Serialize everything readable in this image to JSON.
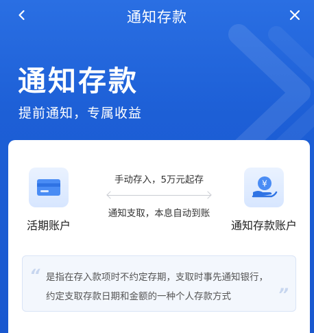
{
  "nav": {
    "title": "通知存款",
    "back_icon": "chevron-left-icon",
    "close_icon": "close-icon"
  },
  "hero": {
    "title": "通知存款",
    "subtitle": "提前通知，专属收益"
  },
  "card": {
    "left_account": {
      "label": "活期账户",
      "icon": "bank-card-icon"
    },
    "right_account": {
      "label": "通知存款账户",
      "icon": "hand-coin-icon",
      "currency_symbol": "¥"
    },
    "flow": {
      "top_text": "手动存入，5万元起存",
      "bottom_text": "通知支取，本息自动到账"
    },
    "note": {
      "text": "是指在存入款项时不约定存期，支取时事先通知银行，约定支取存款日期和金额的一种个人存款方式"
    }
  },
  "colors": {
    "header_blue": "#1f62d8",
    "card_background": "#ffffff",
    "icon_blue": "#4a8cf4",
    "note_background": "#f3f7fd"
  }
}
